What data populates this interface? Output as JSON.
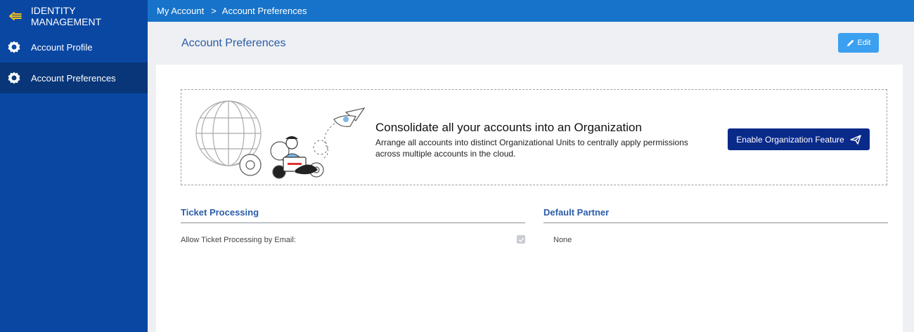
{
  "sidebar": {
    "title": "IDENTITY MANAGEMENT",
    "items": [
      {
        "label": "Account Profile",
        "icon": "gear-icon"
      },
      {
        "label": "Account Preferences",
        "icon": "gear-icon"
      }
    ]
  },
  "breadcrumb": {
    "root": "My Account",
    "separator": ">",
    "current": "Account Preferences"
  },
  "header": {
    "title": "Account Preferences",
    "edit_label": "Edit"
  },
  "banner": {
    "title": "Consolidate all your accounts into an Organization",
    "description": "Arrange all accounts into distinct Organizational Units to centrally apply permissions across multiple accounts in the cloud.",
    "button_label": "Enable Organization Feature"
  },
  "ticket_processing": {
    "title": "Ticket Processing",
    "field_label": "Allow Ticket Processing by Email:",
    "checked": true
  },
  "default_partner": {
    "title": "Default Partner",
    "value": "None"
  },
  "colors": {
    "sidebar": "#0a47a3",
    "topbar": "#1773c9",
    "accent": "#2a5ca8",
    "button_primary": "#0a2a8a",
    "edit_button": "#3ba0f0"
  }
}
